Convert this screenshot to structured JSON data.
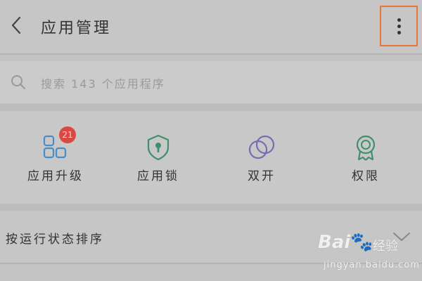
{
  "header": {
    "title": "应用管理",
    "back_icon": "chevron-left-icon",
    "more_icon": "more-vertical-icon",
    "highlight_color": "#e8743a"
  },
  "search": {
    "placeholder": "搜索 143 个应用程序",
    "icon": "search-icon"
  },
  "shortcuts": [
    {
      "label": "应用升级",
      "icon": "app-grid-icon",
      "badge": "21",
      "color": "#4a8cc4"
    },
    {
      "label": "应用锁",
      "icon": "shield-lock-icon",
      "color": "#3f8f6e"
    },
    {
      "label": "双开",
      "icon": "dual-circles-icon",
      "color": "#7a6bb0"
    },
    {
      "label": "权限",
      "icon": "award-ribbon-icon",
      "color": "#3f8f6e"
    }
  ],
  "sort": {
    "label": "按运行状态排序",
    "icon": "chevron-down-icon"
  },
  "watermark": {
    "logo_text": "Bai",
    "logo_suffix": "du",
    "brand": "经验",
    "url": "jingyan.baidu.com"
  }
}
